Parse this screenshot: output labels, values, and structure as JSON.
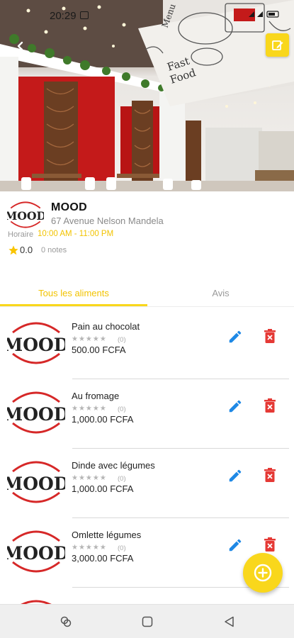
{
  "status_bar": {
    "time": "20:29"
  },
  "restaurant": {
    "name": "MOOD",
    "address": "67 Avenue Nelson Mandela",
    "hours_label": "Horaire",
    "hours": "10:00 AM - 11:00 PM",
    "rating": "0.0",
    "notes_count": "0 notes",
    "logo_text": "MOOD"
  },
  "tabs": [
    {
      "label": "Tous les aliments",
      "active": true
    },
    {
      "label": "Avis",
      "active": false
    }
  ],
  "foods": [
    {
      "name": "Pain au chocolat",
      "stars": "★★★★★",
      "reviews": "(0)",
      "price": "500.00 FCFA"
    },
    {
      "name": "Au fromage",
      "stars": "★★★★★",
      "reviews": "(0)",
      "price": "1,000.00 FCFA"
    },
    {
      "name": "Dinde avec légumes",
      "stars": "★★★★★",
      "reviews": "(0)",
      "price": "1,000.00 FCFA"
    },
    {
      "name": "Omlette légumes",
      "stars": "★★★★★",
      "reviews": "(0)",
      "price": "3,000.00 FCFA"
    }
  ],
  "colors": {
    "accent": "#f9d71c",
    "edit": "#1e88e5",
    "delete": "#e53935",
    "logo_red": "#d62828"
  },
  "icons": {
    "back": "back-arrow-icon",
    "edit_header": "edit-note-icon",
    "star": "star-icon",
    "edit": "pencil-icon",
    "delete": "trash-icon",
    "add": "add-circle-icon",
    "nav_recents": "recents-icon",
    "nav_home": "home-icon",
    "nav_back": "triangle-back-icon"
  }
}
